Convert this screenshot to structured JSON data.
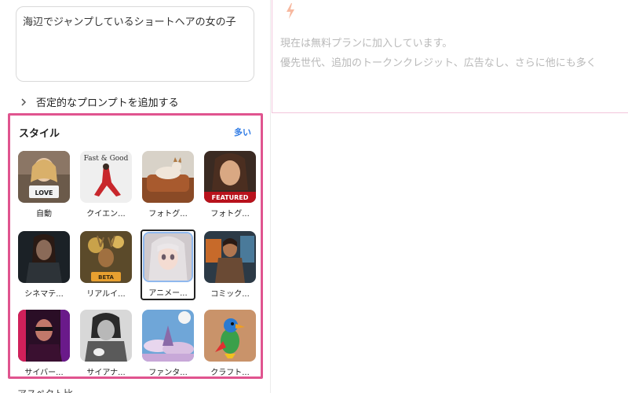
{
  "prompt": {
    "text": "海辺でジャンプしているショートヘアの女の子"
  },
  "negative_prompt": {
    "label": "否定的なプロンプトを追加する",
    "icon": "chevron-right-icon"
  },
  "styles": {
    "title": "スタイル",
    "more_label": "多い",
    "accent_color": "#e0548f",
    "link_color": "#2f7be5",
    "items": [
      {
        "label": "自動",
        "thumb_text": "LOVE"
      },
      {
        "label": "クイエン...",
        "thumb_text": "Fast & Good"
      },
      {
        "label": "フォトグ..."
      },
      {
        "label": "フォトグ...",
        "thumb_text": "FEATURED"
      },
      {
        "label": "シネマテ..."
      },
      {
        "label": "リアルイ...",
        "thumb_text": "BETA"
      },
      {
        "label": "アニメー...",
        "selected": true
      },
      {
        "label": "コミック..."
      },
      {
        "label": "サイバー..."
      },
      {
        "label": "サイアナ..."
      },
      {
        "label": "ファンタ..."
      },
      {
        "label": "クラフト..."
      }
    ]
  },
  "bottom_section": {
    "label": "アスペクト比"
  },
  "plan_notice": {
    "icon": "lightning-icon",
    "line1": "現在は無料プランに加入しています。",
    "line2": "優先世代、追加のトークンクレジット、広告なし、さらに他にも多く"
  }
}
